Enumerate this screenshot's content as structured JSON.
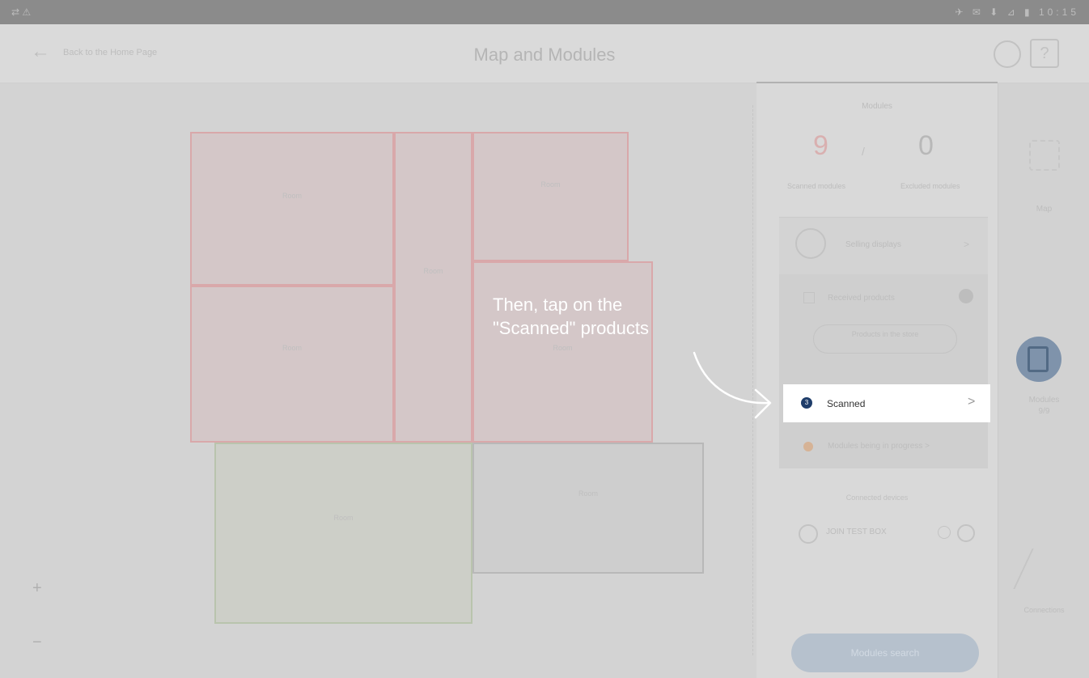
{
  "status_bar": {
    "left": "⇄ ⚠",
    "right": "✈ ✉ ⬇ ⊿ ▮ 10:15"
  },
  "header": {
    "back_icon": "arrow-left-icon",
    "back_label": "Back to the Home Page",
    "title": "Map and Modules",
    "help_label": "?"
  },
  "map": {
    "rooms": [
      {
        "label": "Room",
        "color": "red"
      },
      {
        "label": "Room",
        "color": "red"
      },
      {
        "label": "Room",
        "color": "red"
      },
      {
        "label": "Room",
        "color": "red"
      },
      {
        "label": "Room",
        "color": "red"
      },
      {
        "label": "Room",
        "color": "green"
      },
      {
        "label": "Room",
        "color": "gray"
      }
    ],
    "zoom_in": "+",
    "zoom_out": "−"
  },
  "panel": {
    "heading": "Modules",
    "scanned_count": "9",
    "separator": "/",
    "excluded_count": "0",
    "scanned_modules_label": "Scanned modules",
    "excluded_modules_label": "Excluded modules",
    "selling_label": "Selling displays",
    "selling_chevron": ">",
    "received_label": "Received products",
    "products_btn": "Products in the store",
    "scanned_row": {
      "badge": "3",
      "label": "Scanned",
      "chevron": ">"
    },
    "in_progress_label": "Modules being in progress >",
    "detected_label": "Connected devices",
    "device_label": "JOIN TEST BOX",
    "search_button": "Modules search"
  },
  "right_nav": {
    "map": "Map",
    "modules": "Modules",
    "modules_sub": "9/9",
    "connections": "Connections"
  },
  "tip": {
    "line1": "Then, tap on the",
    "line2": "\"Scanned\" products"
  },
  "colors": {
    "accent": "#1f3d6a",
    "highlight": "#ffffff",
    "overlay": "#d6d6d6"
  }
}
